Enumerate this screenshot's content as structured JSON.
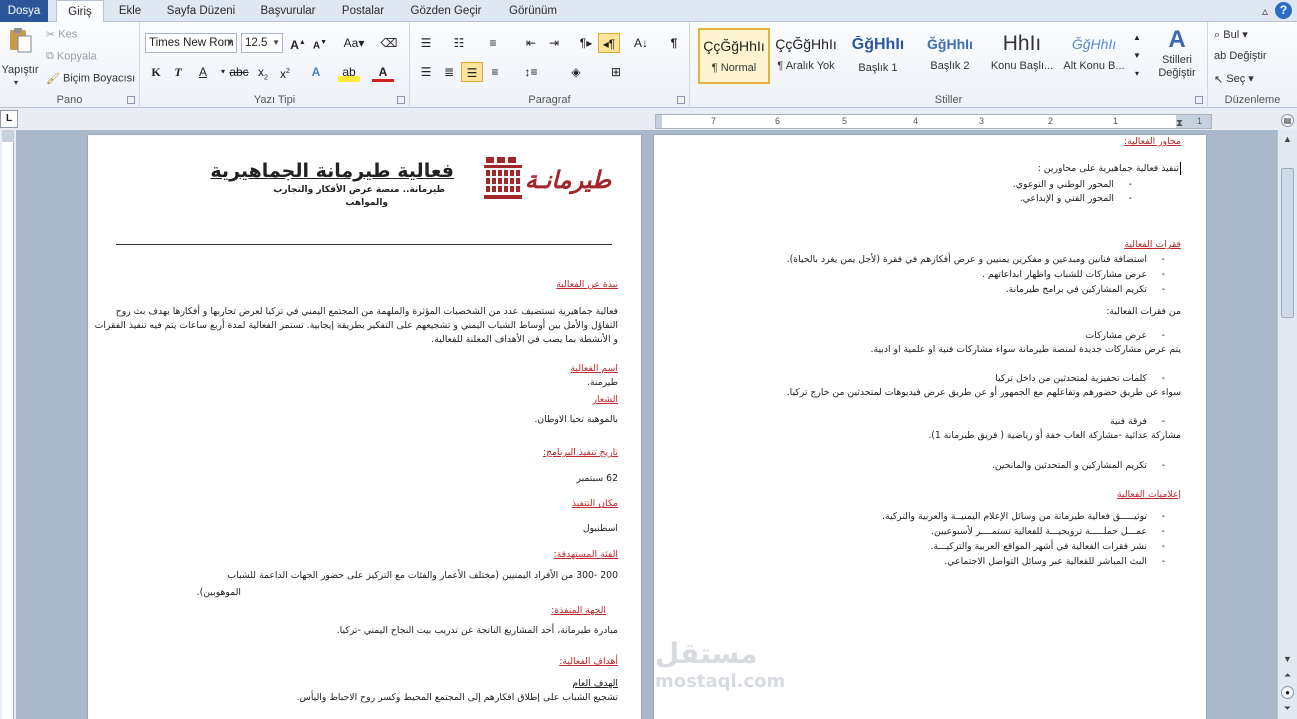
{
  "tabs": [
    "Dosya",
    "Giriş",
    "Ekle",
    "Sayfa Düzeni",
    "Başvurular",
    "Postalar",
    "Gözden Geçir",
    "Görünüm"
  ],
  "ribbon": {
    "clipboard": {
      "label": "Pano",
      "paste": "Yapıştır",
      "cut": "Kes",
      "copy": "Kopyala",
      "format_painter": "Biçim Boyacısı"
    },
    "font": {
      "label": "Yazı Tipi",
      "font_name": "Times New Rom",
      "font_size": "12.5"
    },
    "paragraph": {
      "label": "Paragraf"
    },
    "styles": {
      "label": "Stiller",
      "change_styles": "Stilleri Değiştir",
      "items": [
        {
          "sample": "ÇçĞğHhIı",
          "name": "¶ Normal"
        },
        {
          "sample": "ÇçĞğHhIı",
          "name": "¶ Aralık Yok"
        },
        {
          "sample": "ĞğHhIı",
          "name": "Başlık 1"
        },
        {
          "sample": "ĞğHhIı",
          "name": "Başlık 2"
        },
        {
          "sample": "HhIı",
          "name": "Konu Başlı..."
        },
        {
          "sample": "ĞğHhIı",
          "name": "Alt Konu B..."
        }
      ]
    },
    "editing": {
      "label": "Düzenleme",
      "find": "Bul",
      "replace": "Değiştir",
      "select": "Seç"
    }
  },
  "ruler": {
    "ticks": [
      "7",
      "6",
      "5",
      "4",
      "3",
      "2",
      "1",
      "1"
    ],
    "corner": "L"
  },
  "page1": {
    "logo_text": "طيرمانـة",
    "title": "فعالية طيرمانة الجماهيرية",
    "subtitle_1": "طيرمانة.. منصة عرض الأفكار والتجارب",
    "subtitle_2": "والمواهب",
    "about_heading": "نبذة عن الفعالية",
    "about_line_1": "فعالية جماهيرية تستضيف عدد من الشخصيات المؤثرة والملهمة من المجتمع اليمني في تركيا لعرض تجاربها و أفكارها بهدف بث روح",
    "about_line_2": "التفاؤل والأمل بين أوساط الشباب اليمني و تشجيعهم على التفكير بطريقة إيجابية. تستمر الفعالية لمدة أربع ساعات يتم فيه تنفيذ الفقرات",
    "about_line_3": "و الأنشطة بما يصب في الأهداف المعلنة للفعالية.",
    "name_heading": "اسم الفعالية",
    "name_value": "طيرمنة.",
    "slogan_heading": "الشعار",
    "slogan_value": "بالموهبة تحيا الاوطان.",
    "date_heading": "تاريخ تنفيذ البرنامج:",
    "date_value": "62 سبتمبر",
    "place_heading": "مكان التنفيذ",
    "place_value": "اسطنبول",
    "target_heading": "الفئة المستهدفة:",
    "target_line_1": "200 -300 من الأفراد اليمنيين (مختلف الأعمار والفئات مع التركيز على حضور الجهات الداعمة للشباب",
    "target_line_2": "الموهوبين).",
    "org_heading": "الجهة المنفذة:",
    "org_value": "مبادرة طيرمانة، أحد المشاريع الناتجة عن تدريب بيت النجاح اليمني -تركيا.",
    "goals_heading": "أهداف الفعالية:",
    "general_goal_heading": "الهدف العام",
    "general_goal_value": "تشجيع الشباب على إطلاق افكارهم إلى المجتمع المحيط وكسر روح الاحباط واليأس."
  },
  "page2": {
    "axes_heading": "محاور الفعالية:",
    "axes_intro": "تنفيذ فعالية جماهيرية على محاورين :",
    "axes": [
      "المحور الوطني و التوعوي.",
      "المحور الفني و الإبداعي."
    ],
    "segments_heading": "فقرات الفعالية",
    "segments": [
      "استضافة فنانين ومبدعين و مفكرين يمنيين و عرض أفكارهم في فقرة (لأجل يمن يغرد بالحياة).",
      "عرض مشاركات للشباب واظهار ابداعاتهم .",
      "تكريم المشاركين في برامج طيرمانة."
    ],
    "from_segments": "من فقرات الفعالية:",
    "item_1_title": "عرض مشاركات",
    "item_1_desc": "يتم عرض مشاركات جديدة لمنصة طيرمانة سواء مشاركات فنية او علمية او ادبية.",
    "item_2_title": "كلمات تحفيزية لمتحدثين من داخل تركيا",
    "item_2_desc": "سواء عن طريق حضورهم وتفاعلهم مع الجمهور أو عن طريق عرض فيديوهات لمتحدثين من خارج تركيا.",
    "item_3_title": "فرقة فنية",
    "item_3_desc": "مشاركة عدائية -مشاركة العاب خفة أو رياضية ( فريق طيرمانة 1).",
    "item_4_title": "تكريم المشاركين و المتحدثين والمانحين.",
    "media_heading": "إعلاميات الفعالية",
    "media": [
      "توثيـــــق فعالية طيرمانة من وسائل الإعلام اليمنيــة والعربية والتركية.",
      "عمـــل حملـــــة ترويجيـــة للفعالية تستمــــر لأسبوعيين.",
      "نشر فقرات الفعالية في أشهر المواقع العربية والتركيـــة.",
      "البث المباشر للفعالية عبر وسائل التواصل الاجتماعي."
    ]
  },
  "watermark": {
    "line1": "مستقل",
    "line2": "mostaql.com"
  },
  "colors": {
    "file_tab": "#2b579a",
    "heading_red": "#c0282b",
    "logo_red": "#a3262a"
  }
}
